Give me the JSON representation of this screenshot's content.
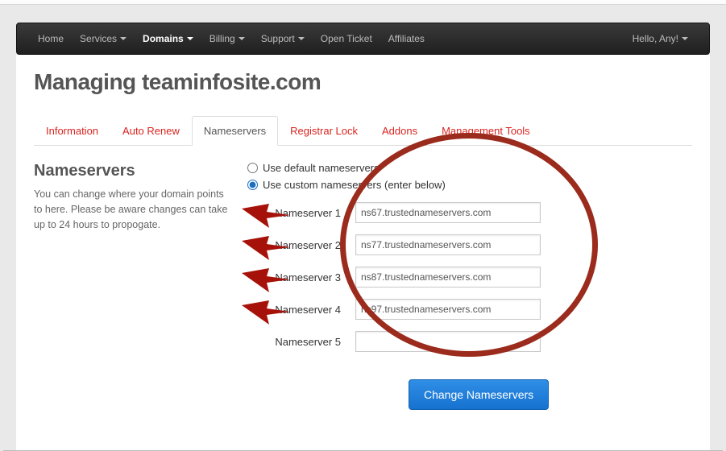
{
  "nav": {
    "items": [
      {
        "label": "Home",
        "caret": false
      },
      {
        "label": "Services",
        "caret": true
      },
      {
        "label": "Domains",
        "caret": true,
        "active": true
      },
      {
        "label": "Billing",
        "caret": true
      },
      {
        "label": "Support",
        "caret": true
      },
      {
        "label": "Open Ticket",
        "caret": false
      },
      {
        "label": "Affiliates",
        "caret": false
      }
    ],
    "greeting": "Hello, Any!"
  },
  "page": {
    "title": "Managing teaminfosite.com"
  },
  "tabs": [
    {
      "label": "Information"
    },
    {
      "label": "Auto Renew"
    },
    {
      "label": "Nameservers",
      "active": true
    },
    {
      "label": "Registrar Lock"
    },
    {
      "label": "Addons"
    },
    {
      "label": "Management Tools",
      "caret": true
    }
  ],
  "sidebar": {
    "heading": "Nameservers",
    "text": "You can change where your domain points to here. Please be aware changes can take up to 24 hours to propogate."
  },
  "form": {
    "default_label": "Use default nameservers",
    "custom_label": "Use custom nameservers (enter below)",
    "mode": "custom",
    "fields": [
      {
        "label": "Nameserver 1",
        "value": "ns67.trustednameservers.com"
      },
      {
        "label": "Nameserver 2",
        "value": "ns77.trustednameservers.com"
      },
      {
        "label": "Nameserver 3",
        "value": "ns87.trustednameservers.com"
      },
      {
        "label": "Nameserver 4",
        "value": "ns97.trustednameservers.com"
      },
      {
        "label": "Nameserver 5",
        "value": ""
      }
    ],
    "submit": "Change Nameservers"
  }
}
